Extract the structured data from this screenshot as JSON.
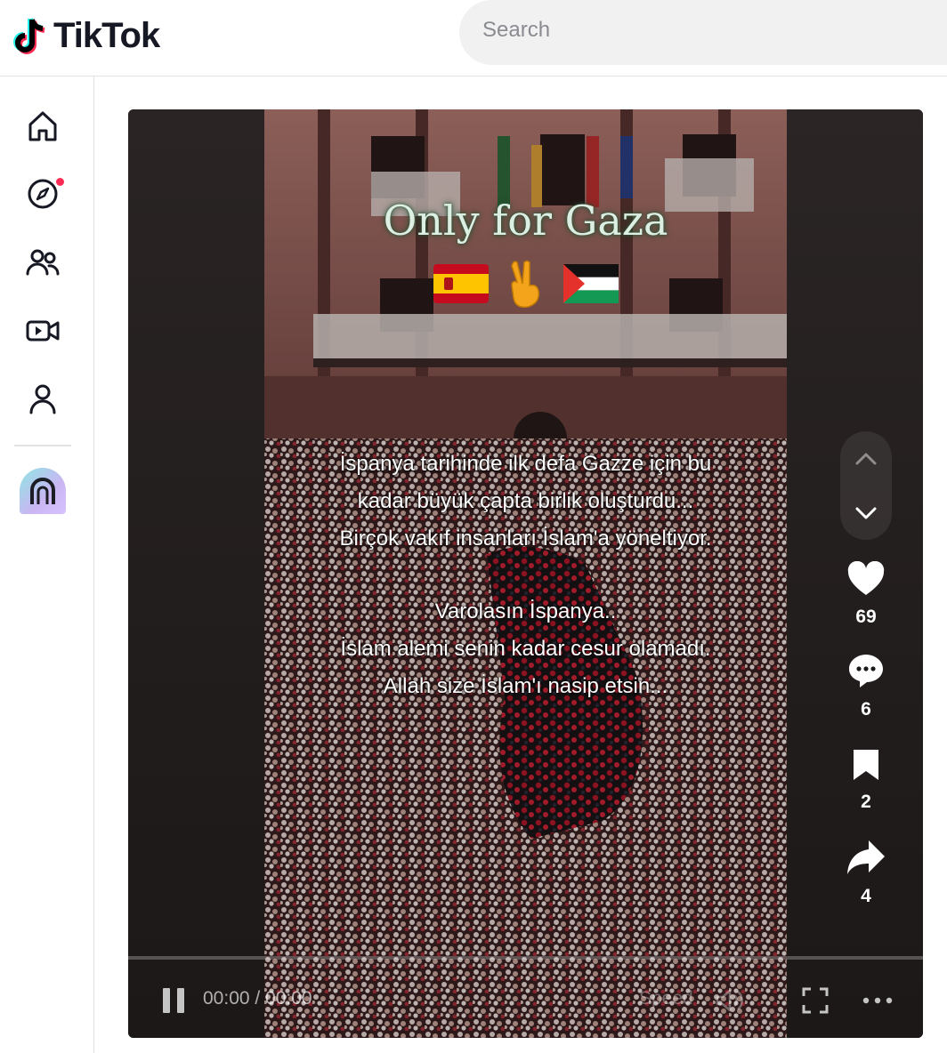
{
  "header": {
    "logo_text": "TikTok",
    "search_placeholder": "Search"
  },
  "sidebar": {
    "items": [
      {
        "name": "home-icon"
      },
      {
        "name": "explore-icon",
        "has_dot": true
      },
      {
        "name": "following-icon"
      },
      {
        "name": "live-icon"
      },
      {
        "name": "profile-icon"
      }
    ]
  },
  "video": {
    "overlay_title": "Only for Gaza",
    "emojis": [
      "spain-flag",
      "victory-hand",
      "palestine-flag"
    ],
    "caption_lines_1": [
      "İspanya tarihinde ilk defa Gazze için bu",
      "kadar büyük çapta birlik oluşturdu...",
      "Birçok vakıf insanları İslam'a yöneltiyor."
    ],
    "caption_lines_2": [
      "Varolasın İspanya..",
      "İslam alemi senin kadar cesur olamadı.",
      "Allah size İslam'ı nasip etsin..."
    ]
  },
  "actions": {
    "likes": "69",
    "comments": "6",
    "saves": "2",
    "shares": "4"
  },
  "controls": {
    "time": "00:00 / 00:00",
    "speed_label": "Speed"
  },
  "colors": {
    "accent": "#fe2c55",
    "tiktok_cyan": "#25f4ee",
    "text_dark": "#161823"
  }
}
